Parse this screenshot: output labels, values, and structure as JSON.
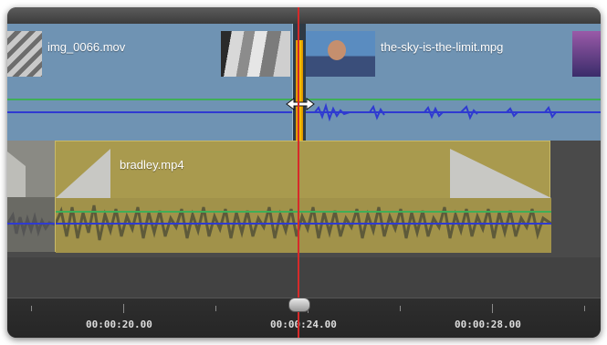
{
  "tracks": [
    {
      "clips": [
        {
          "name": "img_0066.mov"
        },
        {
          "name": "the-sky-is-the-limit.mpg"
        }
      ]
    },
    {
      "clips": [
        {
          "name": "bradley.mp4"
        }
      ]
    }
  ],
  "ruler": {
    "timecodes": [
      "00:00:20.00",
      "00:00:24.00",
      "00:00:28.00"
    ]
  },
  "colors": {
    "video_clip": "#6f93b3",
    "audio_clip": "#a99a4e",
    "playhead": "#d62a2a",
    "edit_point": "#ffd200",
    "volume_line": "#3fae57",
    "waveform": "#2f3ad1"
  },
  "icons": {
    "cursor": "horizontal-resize-icon",
    "playhead_handle": "playhead-knob"
  }
}
